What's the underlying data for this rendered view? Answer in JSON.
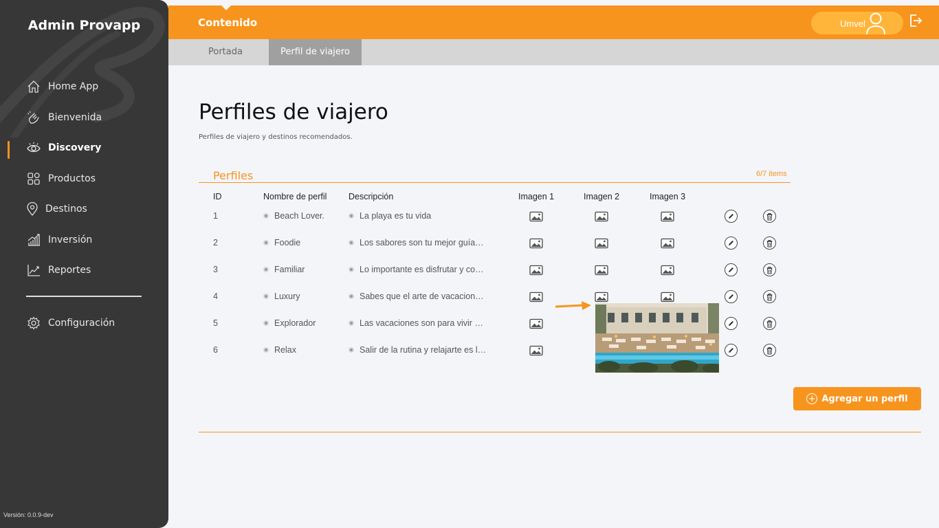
{
  "app": {
    "brand": "Admin Provapp",
    "version": "Versión: 0.0.9-dev"
  },
  "sidebar": {
    "items": [
      {
        "label": "Home App",
        "icon": "home-icon"
      },
      {
        "label": "Bienvenida",
        "icon": "waving-hand-icon"
      },
      {
        "label": "Discovery",
        "icon": "eye-icon",
        "active": true
      },
      {
        "label": "Productos",
        "icon": "grid-icon"
      },
      {
        "label": "Destinos",
        "icon": "map-pin-icon"
      },
      {
        "label": "Inversión",
        "icon": "bar-growth-icon"
      },
      {
        "label": "Reportes",
        "icon": "line-chart-icon"
      },
      {
        "label": "Configuración",
        "icon": "gear-icon"
      }
    ]
  },
  "header": {
    "title": "Contenido",
    "user": "Umvel"
  },
  "tabs": [
    {
      "label": "Portada"
    },
    {
      "label": "Perfil de viajero",
      "active": true
    }
  ],
  "page": {
    "title": "Perfiles de viajero",
    "subtitle": "Perfiles de viajero y destinos recomendados."
  },
  "section": {
    "title": "Perfiles",
    "count": "6/7 items"
  },
  "table": {
    "headers": [
      "ID",
      "Nombre de perfil",
      "Descripción",
      "Imagen 1",
      "Imagen 2",
      "Imagen 3"
    ],
    "rows": [
      {
        "id": "1",
        "name": "Beach Lover.",
        "desc": "La playa es tu vida"
      },
      {
        "id": "2",
        "name": "Foodie",
        "desc": "Los sabores son tu mejor guía…"
      },
      {
        "id": "3",
        "name": "Familiar",
        "desc": "Lo importante es disfrutar y co…"
      },
      {
        "id": "4",
        "name": "Luxury",
        "desc": "Sabes que el arte de vacacion…"
      },
      {
        "id": "5",
        "name": "Explorador",
        "desc": "Las vacaciones son para vivir …"
      },
      {
        "id": "6",
        "name": "Relax",
        "desc": "Salir de la rutina y relajarte es l…"
      }
    ]
  },
  "actions": {
    "add": "Agregar un perfil"
  },
  "colors": {
    "accent": "#f7941d",
    "sidebar": "#373737"
  }
}
